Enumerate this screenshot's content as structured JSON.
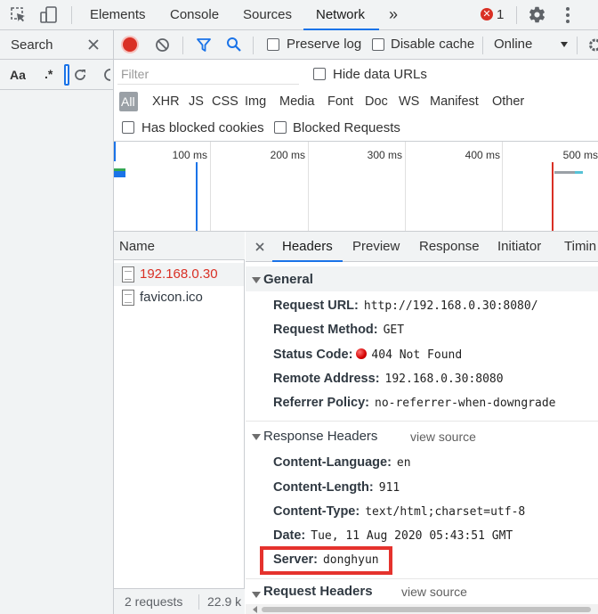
{
  "toptabs": {
    "items": [
      "Elements",
      "Console",
      "Sources",
      "Network"
    ],
    "active": "Network",
    "more": "»",
    "error_count": "1"
  },
  "search": {
    "label": "Search",
    "case_label": "Aa",
    "regex_label": ".*"
  },
  "toolbar": {
    "preserve_log": "Preserve log",
    "disable_cache": "Disable cache",
    "throttle": "Online"
  },
  "filter": {
    "placeholder": "Filter",
    "hide_data_urls": "Hide data URLs",
    "types": [
      "All",
      "XHR",
      "JS",
      "CSS",
      "Img",
      "Media",
      "Font",
      "Doc",
      "WS",
      "Manifest",
      "Other"
    ],
    "has_blocked_cookies": "Has blocked cookies",
    "blocked_requests": "Blocked Requests"
  },
  "timeline": {
    "ticks": [
      "100 ms",
      "200 ms",
      "300 ms",
      "400 ms",
      "500 ms"
    ]
  },
  "requests": {
    "header": "Name",
    "items": [
      {
        "name": "192.168.0.30"
      },
      {
        "name": "favicon.ico"
      }
    ],
    "status_count": "2 requests",
    "status_size": "22.9 k"
  },
  "details": {
    "tabs": [
      "Headers",
      "Preview",
      "Response",
      "Initiator",
      "Timin"
    ],
    "active_tab": "Headers",
    "general": {
      "title": "General",
      "rows": [
        {
          "key": "Request URL:",
          "value": "http://192.168.0.30:8080/"
        },
        {
          "key": "Request Method:",
          "value": "GET"
        },
        {
          "key": "Status Code:",
          "value": "404 Not Found"
        },
        {
          "key": "Remote Address:",
          "value": "192.168.0.30:8080"
        },
        {
          "key": "Referrer Policy:",
          "value": "no-referrer-when-downgrade"
        }
      ]
    },
    "response_headers": {
      "title": "Response Headers",
      "view_source": "view source",
      "rows": [
        {
          "key": "Content-Language:",
          "value": "en"
        },
        {
          "key": "Content-Length:",
          "value": "911"
        },
        {
          "key": "Content-Type:",
          "value": "text/html;charset=utf-8"
        },
        {
          "key": "Date:",
          "value": "Tue, 11 Aug 2020 05:43:51 GMT"
        },
        {
          "key": "Server:",
          "value": "donghyun"
        }
      ]
    },
    "request_headers": {
      "title": "Request Headers",
      "view_source": "view source"
    }
  },
  "colors": {
    "accent": "#1a73e8",
    "error": "#d93025",
    "highlight": "#e5322d"
  }
}
